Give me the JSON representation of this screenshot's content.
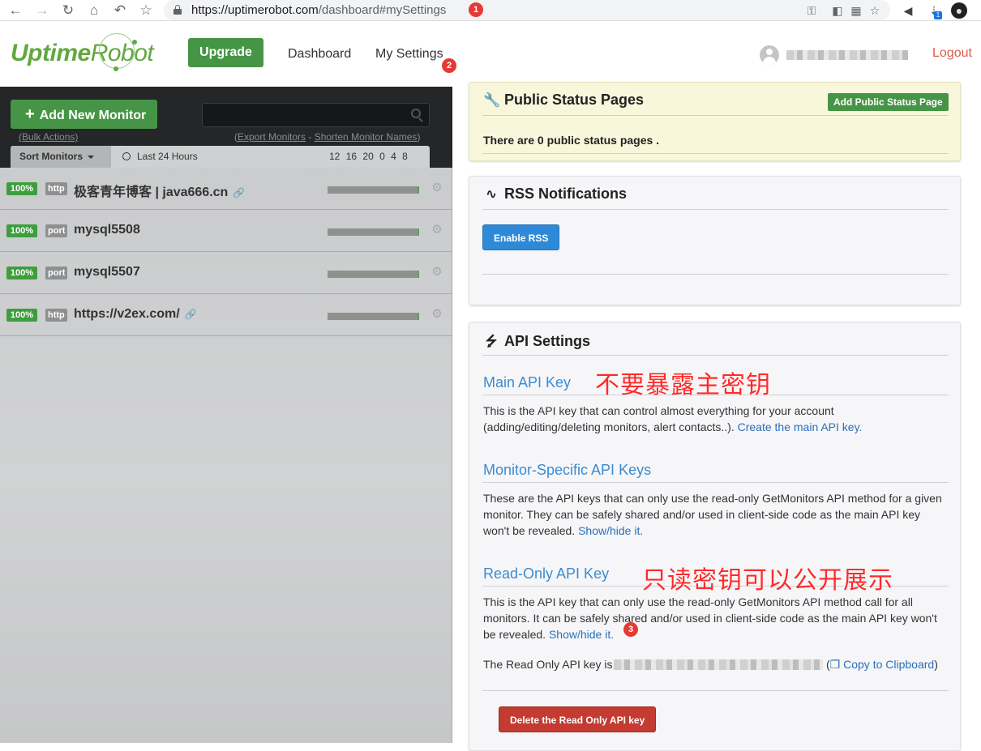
{
  "browser": {
    "url_host": "https://uptimerobot.com",
    "url_path": "/dashboard#mySettings",
    "tab_badge_count": "1",
    "markers": [
      "1",
      "2",
      "3"
    ]
  },
  "header": {
    "logo_bold": "Uptime",
    "logo_light": "Robot",
    "upgrade_label": "Upgrade",
    "nav": [
      "Dashboard",
      "My Settings"
    ],
    "logout_label": "Logout"
  },
  "left": {
    "add_monitor_label": "Add New Monitor",
    "bulk_actions": "(Bulk Actions)",
    "export_monitors": "Export Monitors",
    "export_sep": " - ",
    "shorten_names": "Shorten Monitor Names",
    "sort_label": "Sort Monitors",
    "period_label": "Last 24 Hours",
    "ticks": [
      "12",
      "16",
      "20",
      "0",
      "4",
      "8"
    ],
    "monitors": [
      {
        "uptime": "100%",
        "type": "http",
        "name": "极客青年博客 | java666.cn",
        "link": true
      },
      {
        "uptime": "100%",
        "type": "port",
        "name": "mysql5508",
        "link": false
      },
      {
        "uptime": "100%",
        "type": "port",
        "name": "mysql5507",
        "link": false
      },
      {
        "uptime": "100%",
        "type": "http",
        "name": "https://v2ex.com/",
        "link": true
      }
    ]
  },
  "status_pages": {
    "title": "Public Status Pages",
    "add_label": "Add Public Status Page",
    "empty_text": "There are 0 public status pages ."
  },
  "rss": {
    "title": "RSS Notifications",
    "enable_label": "Enable RSS"
  },
  "api": {
    "title": "API Settings",
    "main_key": {
      "heading": "Main API Key",
      "text": "This is the API key that can control almost everything for your account (adding/editing/deleting monitors, alert contacts..). ",
      "link": "Create the main API key."
    },
    "monitor_keys": {
      "heading": "Monitor-Specific API Keys",
      "text": "These are the API keys that can only use the read-only GetMonitors API method for a given monitor. They can be safely shared and/or used in client-side code as the main API key won't be revealed. ",
      "link": "Show/hide it."
    },
    "readonly_key": {
      "heading": "Read-Only API Key",
      "text": "This is the API key that can only use the read-only GetMonitors API method call for all monitors. It can be safely shared and/or used in client-side code as the main API key won't be revealed. ",
      "link": "Show/hide it.",
      "key_prefix": "The Read Only API key is",
      "copy_open": "(",
      "copy_label": "Copy to Clipboard",
      "copy_close": ")",
      "delete_label": "Delete the Read Only API key"
    }
  },
  "annotations": {
    "main_key_note": "不要暴露主密钥",
    "readonly_note": "只读密钥可以公开展示"
  },
  "colors": {
    "brand_green": "#469546",
    "link_blue": "#3d8bd0",
    "danger_red": "#c43b32",
    "annotation_red": "#ff2a2a"
  }
}
